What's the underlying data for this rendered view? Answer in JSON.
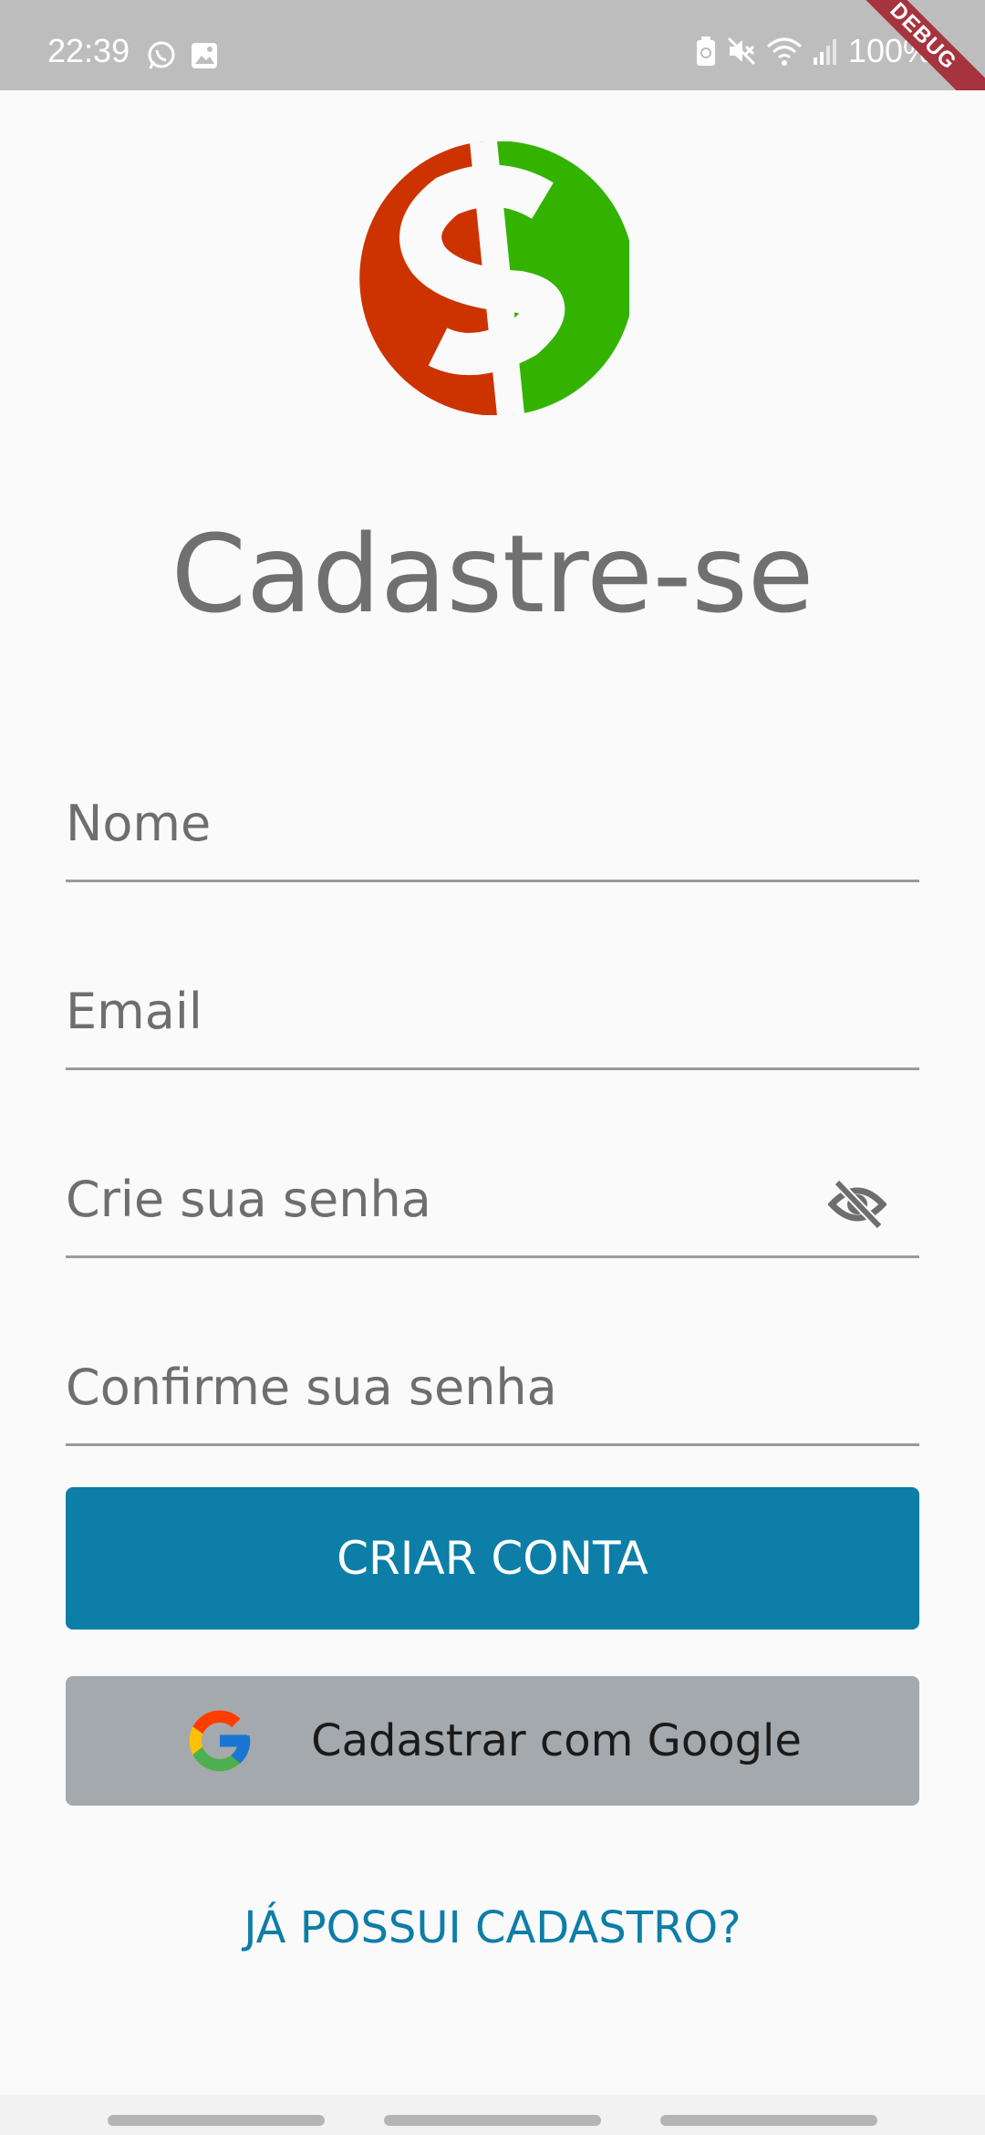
{
  "status_bar": {
    "time": "22:39",
    "left_icons": [
      "whatsapp-icon",
      "image-icon"
    ],
    "right_icons": [
      "battery-saver-icon",
      "mute-icon",
      "wifi-icon",
      "signal-icon"
    ],
    "battery": "100%",
    "debug_banner": "DEBUG"
  },
  "logo": {
    "icon": "dollar-logo-icon",
    "colors": {
      "left": "#cc3300",
      "right": "#33b300"
    }
  },
  "title": "Cadastre-se",
  "form": {
    "fields": [
      {
        "label": "Nome",
        "value": ""
      },
      {
        "label": "Email",
        "value": ""
      },
      {
        "label": "Crie sua senha",
        "value": "",
        "icon": "eye-off-icon"
      },
      {
        "label": "Confirme sua senha",
        "value": ""
      }
    ]
  },
  "buttons": {
    "create_account": "CRIAR CONTA",
    "google_signup": "Cadastrar com Google",
    "already_registered": "JÁ POSSUI CADASTRO?"
  },
  "colors": {
    "accent": "#0c7ea7",
    "google_button": "#a4a9ae",
    "background": "#fafafa"
  }
}
